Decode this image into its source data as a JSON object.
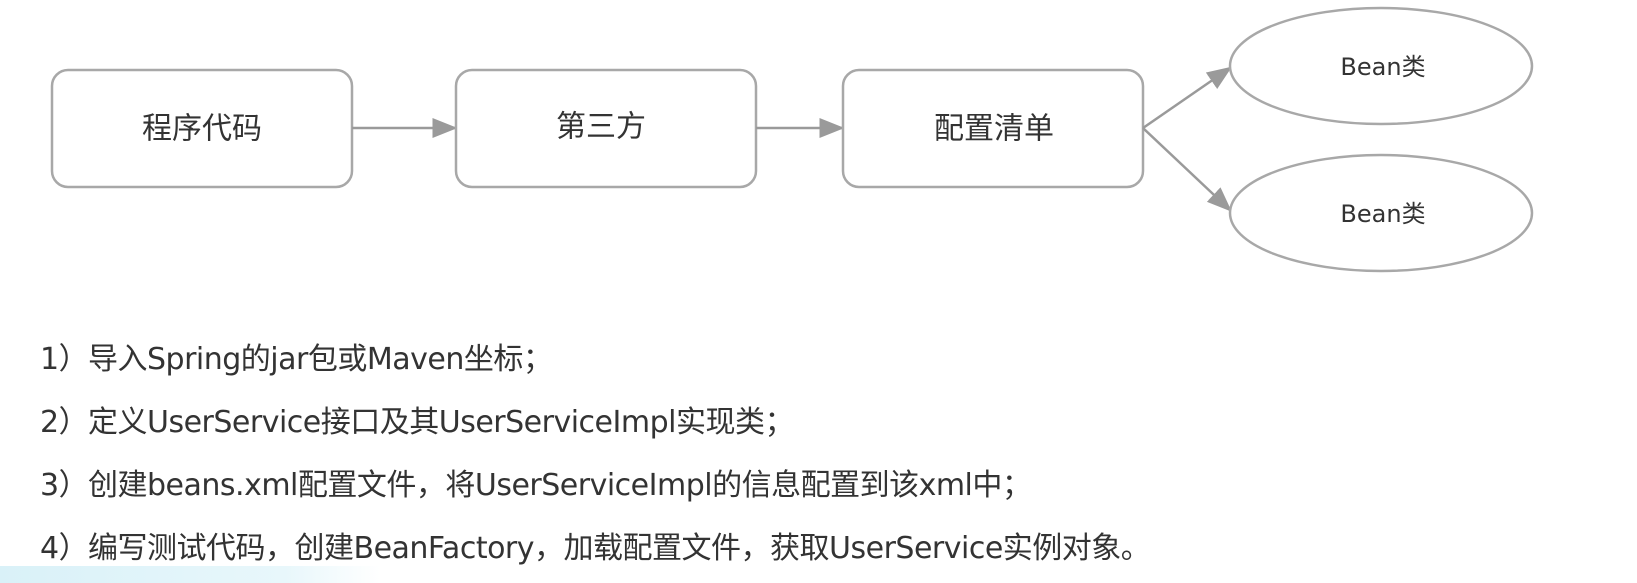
{
  "flow": {
    "boxes": [
      "程序代码",
      "第三方",
      "配置清单"
    ],
    "outputs": [
      "Bean类",
      "Bean类"
    ]
  },
  "steps": [
    {
      "num": "1）",
      "text": "导入Spring的jar包或Maven坐标；"
    },
    {
      "num": "2）",
      "text": "定义UserService接口及其UserServiceImpl实现类；"
    },
    {
      "num": "3）",
      "text": "创建beans.xml配置文件，将UserServiceImpl的信息配置到该xml中；"
    },
    {
      "num": "4）",
      "text": "编写测试代码，创建BeanFactory，加载配置文件，获取UserService实例对象。"
    }
  ],
  "colors": {
    "stroke": "#a8a8a8",
    "arrow": "#9a9a9a",
    "text": "#333333"
  }
}
